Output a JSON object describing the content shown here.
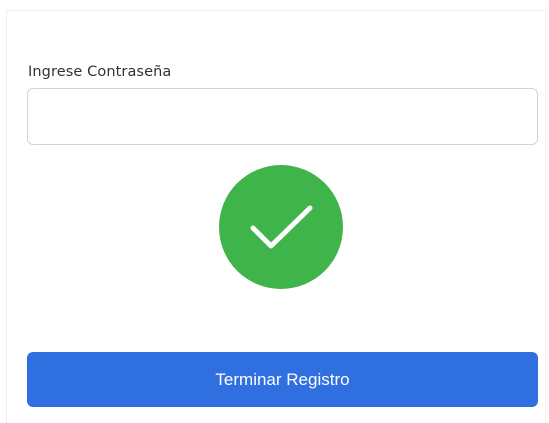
{
  "form": {
    "password_label": "Ingrese Contraseña",
    "password_value": "",
    "password_placeholder": ""
  },
  "status": {
    "icon": "check-circle-icon",
    "color": "#3fb44a"
  },
  "actions": {
    "submit_label": "Terminar Registro",
    "submit_color": "#2f6fe0"
  }
}
